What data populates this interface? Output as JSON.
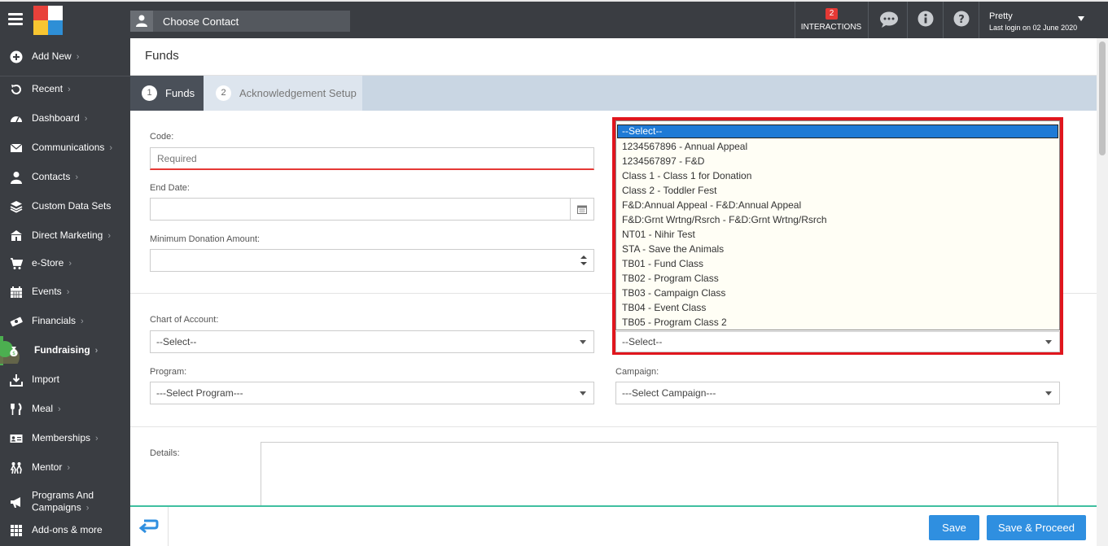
{
  "header": {
    "contact_placeholder": "Choose Contact",
    "interactions_count": "2",
    "interactions_label": "INTERACTIONS",
    "user_name": "Pretty",
    "last_login": "Last login on 02 June 2020"
  },
  "sidebar": {
    "items": [
      {
        "label": "Add New",
        "chevron": "›",
        "icon": "plus-circle-icon"
      },
      {
        "label": "Recent",
        "chevron": "›",
        "icon": "history-icon"
      },
      {
        "label": "Dashboard",
        "chevron": "›",
        "icon": "dashboard-icon"
      },
      {
        "label": "Communications",
        "chevron": "›",
        "icon": "envelope-icon"
      },
      {
        "label": "Contacts",
        "chevron": "›",
        "icon": "user-icon"
      },
      {
        "label": "Custom Data Sets",
        "chevron": "",
        "icon": "layers-icon"
      },
      {
        "label": "Direct Marketing",
        "chevron": "›",
        "icon": "bank-icon"
      },
      {
        "label": "e-Store",
        "chevron": "›",
        "icon": "cart-icon"
      },
      {
        "label": "Events",
        "chevron": "›",
        "icon": "calendar-icon"
      },
      {
        "label": "Financials",
        "chevron": "›",
        "icon": "money-icon"
      },
      {
        "label": "Fundraising",
        "chevron": "›",
        "icon": "money-bag-icon"
      },
      {
        "label": "Import",
        "chevron": "",
        "icon": "download-icon"
      },
      {
        "label": "Meal",
        "chevron": "›",
        "icon": "cutlery-icon"
      },
      {
        "label": "Memberships",
        "chevron": "›",
        "icon": "id-card-icon"
      },
      {
        "label": "Mentor",
        "chevron": "›",
        "icon": "people-icon"
      },
      {
        "label": "Programs And",
        "label2": "Campaigns",
        "chevron": "›",
        "icon": "megaphone-icon"
      },
      {
        "label": "Add-ons & more",
        "chevron": "",
        "icon": "grid-icon"
      }
    ]
  },
  "page": {
    "title": "Funds",
    "tabs": [
      {
        "num": "1",
        "label": "Funds"
      },
      {
        "num": "2",
        "label": "Acknowledgement Setup"
      }
    ]
  },
  "form": {
    "code_label": "Code:",
    "code_placeholder": "Required",
    "end_date_label": "End Date:",
    "min_donation_label": "Minimum Donation Amount:",
    "chart_label": "Chart of Account:",
    "chart_value": "--Select--",
    "program_label": "Program:",
    "program_value": "---Select Program---",
    "campaign_label": "Campaign:",
    "campaign_value": "---Select Campaign---",
    "class_value": "--Select--",
    "details_label": "Details:"
  },
  "dropdown": {
    "options": [
      "--Select--",
      "1234567896 - Annual Appeal",
      "1234567897 - F&D",
      "Class 1 - Class 1 for Donation",
      "Class 2 - Toddler Fest",
      "F&D:Annual Appeal - F&D:Annual Appeal",
      "F&D:Grnt Wrtng/Rsrch - F&D:Grnt Wrtng/Rsrch",
      "NT01 - Nihir Test",
      "STA - Save the Animals",
      "TB01 - Fund Class",
      "TB02 - Program Class",
      "TB03 - Campaign Class",
      "TB04 - Event Class",
      "TB05 - Program Class 2"
    ]
  },
  "footer": {
    "save": "Save",
    "save_proceed": "Save & Proceed"
  },
  "colors": {
    "sidebar_bg": "#3a3d42",
    "accent_green": "#4caf50",
    "button_blue": "#2f8fe0",
    "highlight_red": "#e0161d"
  }
}
